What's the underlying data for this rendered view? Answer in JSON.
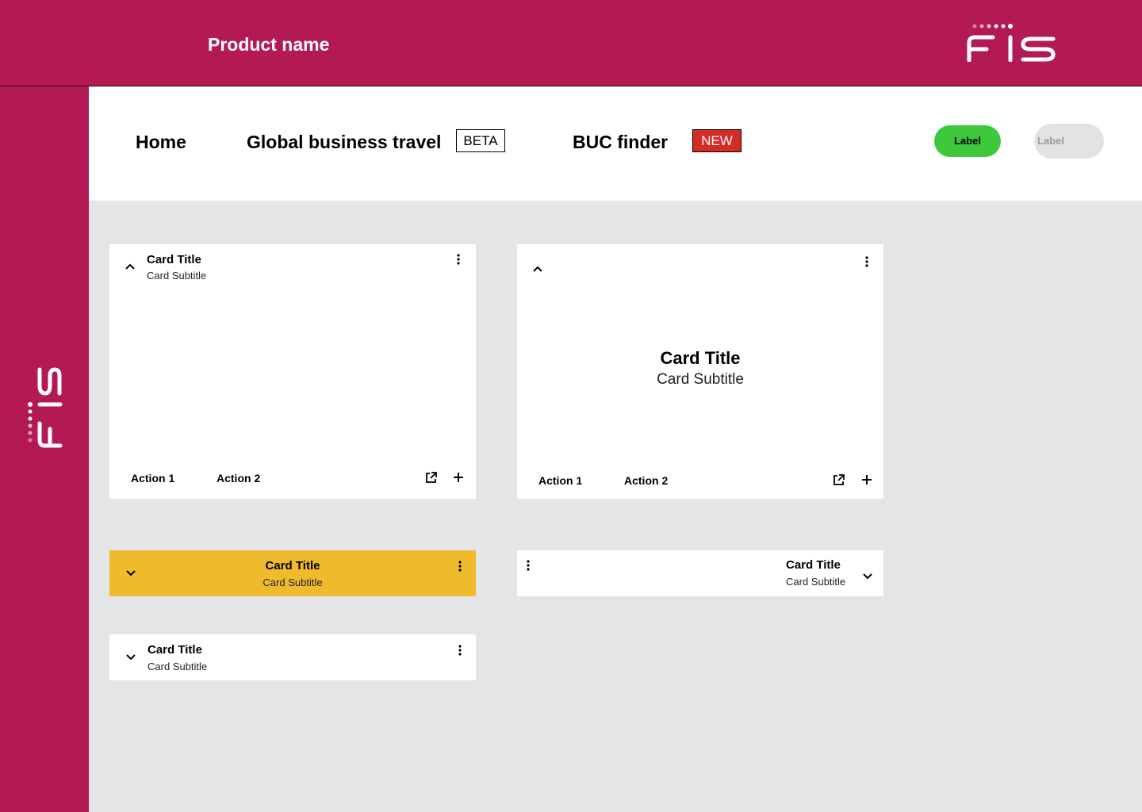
{
  "header": {
    "product_name": "Product name",
    "logo_icon": "fis-logo-icon"
  },
  "sidebar": {
    "logo_icon": "fis-logo-icon"
  },
  "nav": {
    "items": [
      {
        "label": "Home"
      },
      {
        "label": "Global business travel",
        "badge": "BETA"
      },
      {
        "label": "BUC finder",
        "badge": "NEW"
      }
    ],
    "buttons": [
      {
        "label": "Label",
        "state": "active"
      },
      {
        "label": "Label",
        "state": "disabled"
      }
    ]
  },
  "cards": {
    "card1": {
      "title": "Card Title",
      "subtitle": "Card Subtitle",
      "action1": "Action 1",
      "action2": "Action 2"
    },
    "card2": {
      "title": "Card Title",
      "subtitle": "Card Subtitle",
      "action1": "Action 1",
      "action2": "Action 2"
    },
    "card3": {
      "title": "Card Title",
      "subtitle": "Card Subtitle"
    },
    "card4": {
      "title": "Card Title",
      "subtitle": "Card Subtitle"
    },
    "card5": {
      "title": "Card Title",
      "subtitle": "Card Subtitle"
    }
  },
  "colors": {
    "brand": "#b31a54",
    "accent_green": "#3ec93d",
    "badge_new": "#d52b27",
    "card_highlight": "#efbb2c",
    "background": "#e4e5e7"
  }
}
